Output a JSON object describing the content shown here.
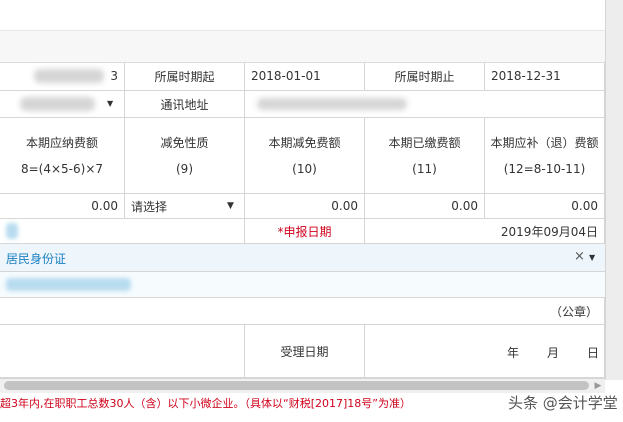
{
  "row1": {
    "period_start_label": "所属时期起",
    "period_start_value": "2018-01-01",
    "period_end_label": "所属时期止",
    "period_end_value": "2018-12-31",
    "partial_value_tail": "3"
  },
  "row2": {
    "address_label": "通讯地址"
  },
  "headers": [
    {
      "title": "本期应纳费额",
      "formula": "8=(4×5-6)×7"
    },
    {
      "title": "减免性质",
      "formula": "(9)"
    },
    {
      "title": "本期减免费额",
      "formula": "(10)"
    },
    {
      "title": "本期已缴费额",
      "formula": "(11)"
    },
    {
      "title": "本期应补（退）费额",
      "formula": "(12=8-10-11)"
    }
  ],
  "values_row": {
    "due": "0.00",
    "relief_select": "请选择",
    "relief_amount": "0.00",
    "paid": "0.00",
    "payable": "0.00"
  },
  "declaration": {
    "date_label": "*申报日期",
    "date_value": "2019年09月04日"
  },
  "id_type": {
    "value": "居民身份证",
    "clear_glyph": "×"
  },
  "seal": {
    "label": "（公章）"
  },
  "acceptance": {
    "date_label": "受理日期",
    "year": "年",
    "month": "月",
    "day": "日"
  },
  "notice": {
    "text": "超3年内,在职职工总数30人（含）以下小微企业。（具体以“财税[2017]18号”为准）"
  },
  "watermark": {
    "text": "头条 @会计学堂"
  },
  "colors": {
    "notice_red": "#d0021b",
    "id_type_blue": "#1a7fc2",
    "required_star": "#d0021b",
    "row_highlight": "#eef6fc"
  }
}
